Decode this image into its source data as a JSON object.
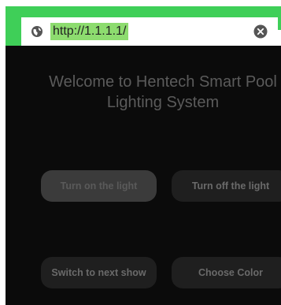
{
  "browser": {
    "url": "http://1.1.1.1/",
    "globe_icon": "globe-icon",
    "clear_icon": "clear-circle-x-icon",
    "accent_color": "#3fcf58"
  },
  "page": {
    "welcome_text": "Welcome to Hentech Smart Pool\nLighting System",
    "background_color": "#0b0b0b",
    "buttons": {
      "turn_on": "Turn on the light",
      "turn_off": "Turn off the light",
      "next_show": "Switch to next show",
      "choose_color": "Choose Color"
    }
  }
}
